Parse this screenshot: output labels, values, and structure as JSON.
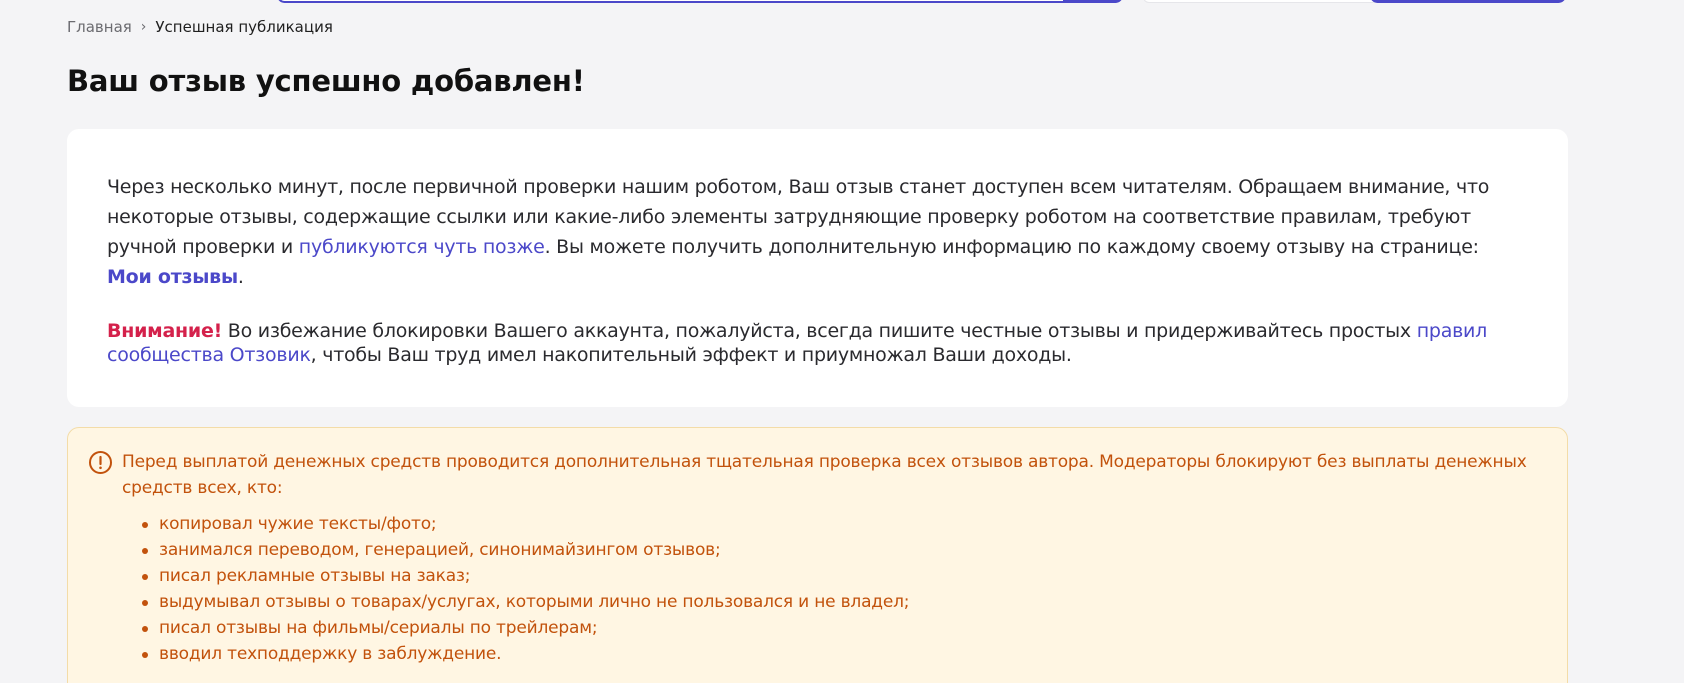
{
  "breadcrumb": {
    "home": "Главная",
    "separator": "›",
    "current": "Успешная публикация"
  },
  "page_title": "Ваш отзыв успешно добавлен!",
  "info": {
    "p1_text": "Через несколько минут, после первичной проверки нашим роботом, Ваш отзыв станет доступен всем читателям. Обращаем внимание, что некоторые отзывы, содержащие ссылки или какие-либо элементы затрудняющие проверку роботом на соответствие правилам, требуют ручной проверки и ",
    "p1_link": "публикуются чуть позже",
    "p1_text2": ". Вы можете получить дополнительную информацию по каждому своему отзыву на странице: ",
    "my_reviews_link": "Мои отзывы",
    "p1_end": ".",
    "warning_label": "Внимание!",
    "p2_text": " Во избежание блокировки Вашего аккаунта, пожалуйста, всегда пишите честные отзывы и придерживайтесь простых ",
    "p2_link": "правил сообщества Отзовик",
    "p2_text2": ", чтобы Ваш труд имел накопительный эффект и приумножал Ваши доходы."
  },
  "alert": {
    "icon": "exclamation-circle-icon",
    "text": "Перед выплатой денежных средств проводится дополнительная тщательная проверка всех отзывов автора. Модераторы блокируют без выплаты денежных средств всех, кто:",
    "items": [
      "копировал чужие тексты/фото;",
      "занимался переводом, генерацией, синонимайзингом отзывов;",
      "писал рекламные отзывы на заказ;",
      "выдумывал отзывы о товарах/услугах, которыми лично не пользовался и не владел;",
      "писал отзывы на фильмы/сериалы по трейлерам;",
      "вводил техподдержку в заблуждение."
    ]
  },
  "colors": {
    "accent": "#4b48c9",
    "warning_red": "#d4214b",
    "alert_text": "#c2520c",
    "alert_bg": "#fff6e3"
  }
}
